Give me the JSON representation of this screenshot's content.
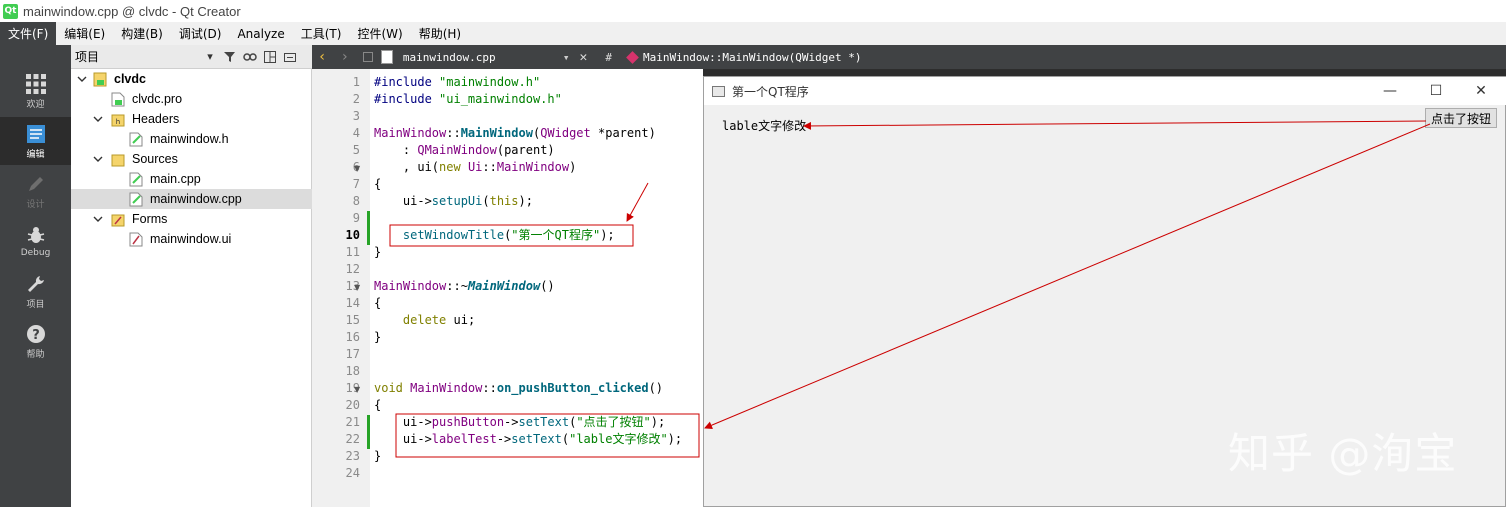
{
  "app": {
    "window_title": "mainwindow.cpp @ clvdc - Qt Creator",
    "logo_text": "Qt"
  },
  "menubar": {
    "items": [
      "文件(F)",
      "编辑(E)",
      "构建(B)",
      "调试(D)",
      "Analyze",
      "工具(T)",
      "控件(W)",
      "帮助(H)"
    ]
  },
  "modes": [
    {
      "label": "欢迎",
      "icon": "grid-icon",
      "state": "normal"
    },
    {
      "label": "编辑",
      "icon": "document-icon",
      "state": "active"
    },
    {
      "label": "设计",
      "icon": "pencil-icon",
      "state": "disabled"
    },
    {
      "label": "Debug",
      "icon": "bug-icon",
      "state": "normal"
    },
    {
      "label": "项目",
      "icon": "wrench-icon",
      "state": "normal"
    },
    {
      "label": "帮助",
      "icon": "help-icon",
      "state": "normal"
    }
  ],
  "project_panel": {
    "title": "项目",
    "tree": [
      {
        "label": "clvdc",
        "level": 0,
        "icon": "project-icon",
        "expanded": true,
        "bold": true
      },
      {
        "label": "clvdc.pro",
        "level": 1,
        "icon": "pro-file-icon"
      },
      {
        "label": "Headers",
        "level": 1,
        "icon": "header-folder-icon",
        "expanded": true
      },
      {
        "label": "mainwindow.h",
        "level": 2,
        "icon": "header-file-icon"
      },
      {
        "label": "Sources",
        "level": 1,
        "icon": "source-folder-icon",
        "expanded": true
      },
      {
        "label": "main.cpp",
        "level": 2,
        "icon": "cpp-file-icon"
      },
      {
        "label": "mainwindow.cpp",
        "level": 2,
        "icon": "cpp-file-icon",
        "selected": true
      },
      {
        "label": "Forms",
        "level": 1,
        "icon": "forms-folder-icon",
        "expanded": true
      },
      {
        "label": "mainwindow.ui",
        "level": 2,
        "icon": "ui-file-icon"
      }
    ]
  },
  "editor": {
    "file_name": "mainwindow.cpp",
    "symbol_hash": "#",
    "symbol": "MainWindow::MainWindow(QWidget *)",
    "current_line": 10,
    "line_numbers": [
      "1",
      "2",
      "3",
      "4",
      "5",
      "6",
      "7",
      "8",
      "9",
      "10",
      "11",
      "12",
      "13",
      "14",
      "15",
      "16",
      "17",
      "18",
      "19",
      "20",
      "21",
      "22",
      "23",
      "24"
    ],
    "lines": {
      "l1a": "#include ",
      "l1b": "\"mainwindow.h\"",
      "l2a": "#include ",
      "l2b": "\"ui_mainwindow.h\"",
      "l4a": "MainWindow",
      "l4b": "::",
      "l4c": "MainWindow",
      "l4d": "(",
      "l4e": "QWidget",
      "l4f": " *parent)",
      "l5a": "    : ",
      "l5b": "QMainWindow",
      "l5c": "(parent)",
      "l6a": "    , ui(",
      "l6b": "new",
      "l6c": " Ui",
      "l6d": "::",
      "l6e": "MainWindow",
      "l6f": ")",
      "l7": "{",
      "l8a": "    ui->",
      "l8b": "setupUi",
      "l8c": "(",
      "l8d": "this",
      "l8e": ");",
      "l10a": "    ",
      "l10b": "setWindowTitle",
      "l10c": "(",
      "l10d": "\"第一个QT程序\"",
      "l10e": ");",
      "l11": "}",
      "l13a": "MainWindow",
      "l13b": "::~",
      "l13c": "MainWindow",
      "l13d": "()",
      "l14": "{",
      "l15a": "    ",
      "l15b": "delete",
      "l15c": " ui;",
      "l16": "}",
      "l19a": "void",
      "l19b": " MainWindow",
      "l19c": "::",
      "l19d": "on_pushButton_clicked",
      "l19e": "()",
      "l20": "{",
      "l21a": "    ui->",
      "l21b": "pushButton",
      "l21c": "->",
      "l21d": "setText",
      "l21e": "(",
      "l21f": "\"点击了按钮\"",
      "l21g": ");",
      "l22a": "    ui->",
      "l22b": "labelTest",
      "l22c": "->",
      "l22d": "setText",
      "l22e": "(",
      "l22f": "\"lable文字修改\"",
      "l22g": ");",
      "l23": "}"
    }
  },
  "running_app": {
    "title": "第一个QT程序",
    "label_text": "lable文字修改",
    "button_text": "点击了按钮"
  },
  "watermark": "知乎 @洵宝",
  "colors": {
    "annotation": "#cc0000",
    "modified_line": "#27a327",
    "dark_panel": "#404244"
  }
}
